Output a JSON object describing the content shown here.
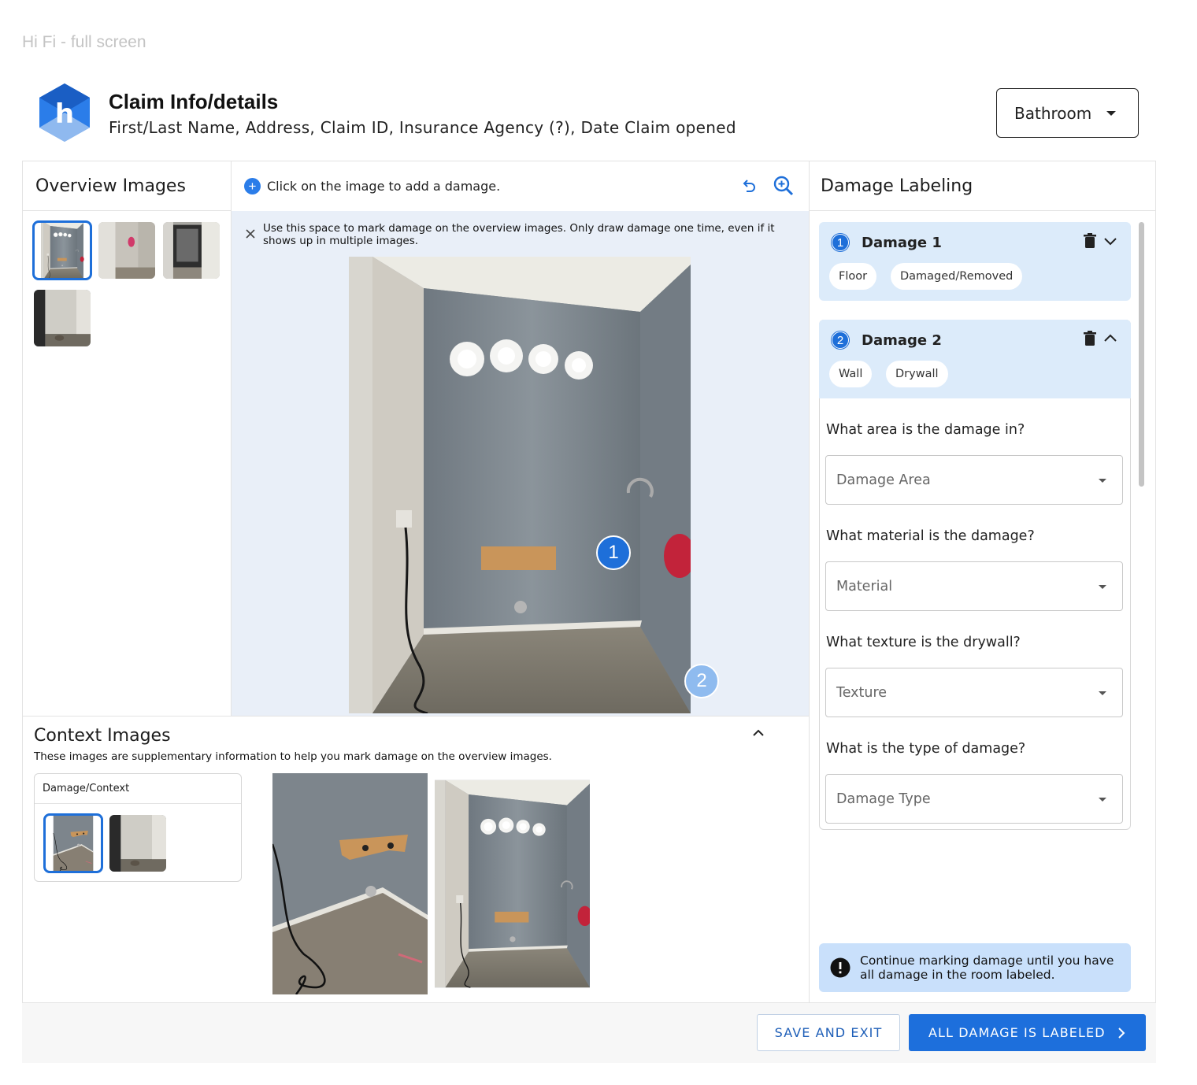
{
  "frame_label": "Hi Fi - full screen",
  "header": {
    "title": "Claim Info/details",
    "subtitle": "First/Last Name, Address, Claim ID, Insurance Agency (?), Date Claim opened",
    "room_select": "Bathroom"
  },
  "overview": {
    "title": "Overview Images",
    "thumb_count": 4,
    "selected_index": 0
  },
  "canvas": {
    "instruction": "Click on the image to add a damage.",
    "notice": "Use this space to mark damage on the overview images. Only draw damage one time, even if it shows up in multiple images.",
    "markers": [
      "1",
      "2"
    ]
  },
  "context": {
    "title": "Context Images",
    "subtitle": "These images are supplementary information to help you mark damage on the overview images.",
    "box_title": "Damage/Context"
  },
  "damage_panel": {
    "title": "Damage Labeling",
    "damages": [
      {
        "number": "1",
        "title": "Damage 1",
        "tags": [
          "Floor",
          "Damaged/Removed"
        ],
        "expanded": false
      },
      {
        "number": "2",
        "title": "Damage 2",
        "tags": [
          "Wall",
          "Drywall"
        ],
        "expanded": true
      }
    ],
    "questions": [
      {
        "label": "What area is the damage in?",
        "placeholder": "Damage Area"
      },
      {
        "label": "What material is the damage?",
        "placeholder": "Material"
      },
      {
        "label": "What texture is the drywall?",
        "placeholder": "Texture"
      },
      {
        "label": "What is the type of damage?",
        "placeholder": "Damage Type"
      }
    ],
    "alert": "Continue marking damage until you have all damage in the room labeled."
  },
  "footer": {
    "save_exit": "SAVE AND EXIT",
    "all_labeled": "ALL DAMAGE IS LABELED"
  },
  "colors": {
    "accent": "#1d6fdc",
    "card_bg": "#dcebfa",
    "canvas_bg": "#e9eff8",
    "alert_bg": "#c9e0fb"
  }
}
